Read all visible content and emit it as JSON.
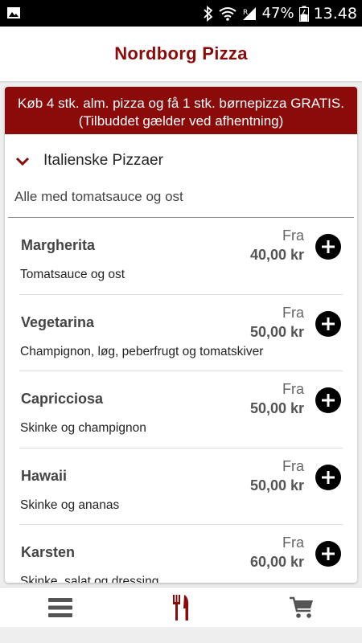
{
  "statusbar": {
    "battery_percent": "47%",
    "time": "13.48",
    "icons": [
      "image-icon",
      "bluetooth-icon",
      "wifi-icon",
      "signal-icon",
      "battery-icon"
    ]
  },
  "app": {
    "title": "Nordborg Pizza",
    "accent_color": "#8b0b0b"
  },
  "promo": {
    "text": "Køb 4 stk. alm. pizza og få 1 stk. børnepizza GRATIS. (Tilbuddet gælder ved afhentning)"
  },
  "category": {
    "title": "Italienske Pizzaer",
    "description": "Alle med tomatsauce og ost",
    "expanded": true
  },
  "items": [
    {
      "name": "Margherita",
      "description": "Tomatsauce og ost",
      "from_label": "Fra",
      "price": "40,00 kr"
    },
    {
      "name": "Vegetarina",
      "description": "Champignon, løg, peberfrugt og tomatskiver",
      "from_label": "Fra",
      "price": "50,00 kr"
    },
    {
      "name": "Capricciosa",
      "description": "Skinke og champignon",
      "from_label": "Fra",
      "price": "50,00 kr"
    },
    {
      "name": "Hawaii",
      "description": "Skinke og ananas",
      "from_label": "Fra",
      "price": "50,00 kr"
    },
    {
      "name": "Karsten",
      "description": "Skinke, salat og dressing",
      "from_label": "Fra",
      "price": "60,00 kr"
    }
  ],
  "bottom_nav": [
    {
      "icon": "menu-icon",
      "active": false
    },
    {
      "icon": "cutlery-icon",
      "active": true
    },
    {
      "icon": "cart-icon",
      "active": false
    }
  ]
}
